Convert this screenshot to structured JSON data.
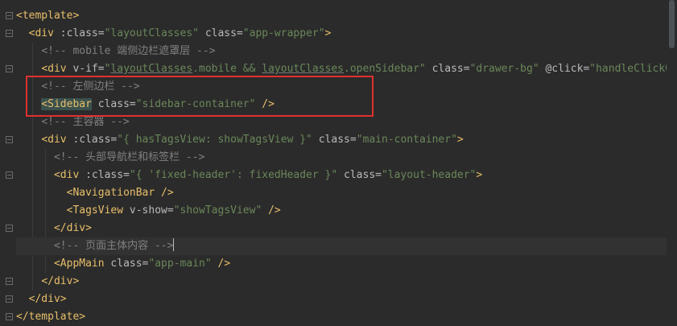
{
  "editor": {
    "lines": [
      [
        {
          "t": "tag",
          "v": "<template>"
        }
      ],
      [
        {
          "t": "txt",
          "v": "  "
        },
        {
          "t": "tag",
          "v": "<div "
        },
        {
          "t": "attr",
          "v": ":class="
        },
        {
          "t": "str",
          "v": "\"layoutClasses\""
        },
        {
          "t": "attr",
          "v": " class="
        },
        {
          "t": "str",
          "v": "\"app-wrapper\""
        },
        {
          "t": "tag",
          "v": ">"
        }
      ],
      [
        {
          "t": "txt",
          "v": "    "
        },
        {
          "t": "cmt",
          "v": "<!-- mobile 端侧边栏遮罩层 -->"
        }
      ],
      [
        {
          "t": "txt",
          "v": "    "
        },
        {
          "t": "tag",
          "v": "<div "
        },
        {
          "t": "attr",
          "v": "v-if="
        },
        {
          "t": "str",
          "v": "\""
        },
        {
          "t": "str-ul",
          "v": "layoutClasses"
        },
        {
          "t": "str",
          "v": ".mobile && "
        },
        {
          "t": "str-ul",
          "v": "layoutClasses"
        },
        {
          "t": "str",
          "v": ".openSidebar\""
        },
        {
          "t": "attr",
          "v": " class="
        },
        {
          "t": "str",
          "v": "\"drawer-bg\""
        },
        {
          "t": "attr",
          "v": " @click="
        },
        {
          "t": "str",
          "v": "\"handleClickOutside\""
        }
      ],
      [
        {
          "t": "txt",
          "v": "    "
        },
        {
          "t": "cmt",
          "v": "<!-- 左侧边栏 -->"
        }
      ],
      [
        {
          "t": "txt",
          "v": "    "
        },
        {
          "t": "tag-hl",
          "v": "<Sidebar"
        },
        {
          "t": "attr",
          "v": " class="
        },
        {
          "t": "str",
          "v": "\"sidebar-container\""
        },
        {
          "t": "tag",
          "v": " />"
        }
      ],
      [
        {
          "t": "txt",
          "v": "    "
        },
        {
          "t": "cmt",
          "v": "<!-- 主容器 -->"
        }
      ],
      [
        {
          "t": "txt",
          "v": "    "
        },
        {
          "t": "tag",
          "v": "<div "
        },
        {
          "t": "attr",
          "v": ":class="
        },
        {
          "t": "str",
          "v": "\"{ hasTagsView: showTagsView }\""
        },
        {
          "t": "attr",
          "v": " class="
        },
        {
          "t": "str",
          "v": "\"main-container\""
        },
        {
          "t": "tag",
          "v": ">"
        }
      ],
      [
        {
          "t": "txt",
          "v": "      "
        },
        {
          "t": "cmt",
          "v": "<!-- 头部导航栏和标签栏 -->"
        }
      ],
      [
        {
          "t": "txt",
          "v": "      "
        },
        {
          "t": "tag",
          "v": "<div "
        },
        {
          "t": "attr",
          "v": ":class="
        },
        {
          "t": "str",
          "v": "\"{ 'fixed-header': fixedHeader }\""
        },
        {
          "t": "attr",
          "v": " class="
        },
        {
          "t": "str",
          "v": "\"layout-header\""
        },
        {
          "t": "tag",
          "v": ">"
        }
      ],
      [
        {
          "t": "txt",
          "v": "        "
        },
        {
          "t": "tag",
          "v": "<NavigationBar />"
        }
      ],
      [
        {
          "t": "txt",
          "v": "        "
        },
        {
          "t": "tag",
          "v": "<TagsView "
        },
        {
          "t": "attr",
          "v": "v-show="
        },
        {
          "t": "str",
          "v": "\"showTagsView\""
        },
        {
          "t": "tag",
          "v": " />"
        }
      ],
      [
        {
          "t": "txt",
          "v": "      "
        },
        {
          "t": "tag",
          "v": "</div>"
        }
      ],
      [
        {
          "t": "txt",
          "v": "      "
        },
        {
          "t": "cmt",
          "v": "<!-- 页面主体内容 -->"
        },
        {
          "t": "caret",
          "v": ""
        }
      ],
      [
        {
          "t": "txt",
          "v": "      "
        },
        {
          "t": "tag",
          "v": "<AppMain "
        },
        {
          "t": "attr",
          "v": "class="
        },
        {
          "t": "str",
          "v": "\"app-main\""
        },
        {
          "t": "tag",
          "v": " />"
        }
      ],
      [
        {
          "t": "txt",
          "v": "    "
        },
        {
          "t": "tag",
          "v": "</div>"
        }
      ],
      [
        {
          "t": "txt",
          "v": "  "
        },
        {
          "t": "tag",
          "v": "</div>"
        }
      ],
      [
        {
          "t": "tag",
          "v": "</template>"
        }
      ]
    ],
    "current_line": 13,
    "folds": [
      0,
      1,
      3,
      7,
      9,
      12,
      15,
      16,
      17
    ],
    "colors": {
      "background": "#2b2b2b",
      "tag": "#e8bf6a",
      "attribute": "#bababa",
      "string": "#6a8759",
      "comment": "#808080",
      "highlight_box": "#e0302e"
    }
  }
}
